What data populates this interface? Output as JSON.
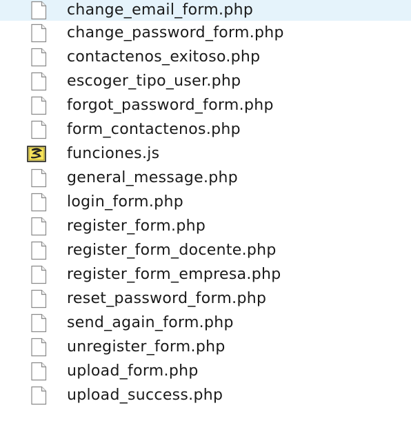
{
  "files": [
    {
      "name": "change_email_form.php",
      "icon": "blank-file-icon"
    },
    {
      "name": "change_password_form.php",
      "icon": "blank-file-icon"
    },
    {
      "name": "contactenos_exitoso.php",
      "icon": "blank-file-icon"
    },
    {
      "name": "escoger_tipo_user.php",
      "icon": "blank-file-icon"
    },
    {
      "name": "forgot_password_form.php",
      "icon": "blank-file-icon"
    },
    {
      "name": "form_contactenos.php",
      "icon": "blank-file-icon"
    },
    {
      "name": "funciones.js",
      "icon": "script-file-icon"
    },
    {
      "name": "general_message.php",
      "icon": "blank-file-icon"
    },
    {
      "name": "login_form.php",
      "icon": "blank-file-icon"
    },
    {
      "name": "register_form.php",
      "icon": "blank-file-icon"
    },
    {
      "name": "register_form_docente.php",
      "icon": "blank-file-icon"
    },
    {
      "name": "register_form_empresa.php",
      "icon": "blank-file-icon"
    },
    {
      "name": "reset_password_form.php",
      "icon": "blank-file-icon"
    },
    {
      "name": "send_again_form.php",
      "icon": "blank-file-icon"
    },
    {
      "name": "unregister_form.php",
      "icon": "blank-file-icon"
    },
    {
      "name": "upload_form.php",
      "icon": "blank-file-icon"
    },
    {
      "name": "upload_success.php",
      "icon": "blank-file-icon"
    }
  ]
}
